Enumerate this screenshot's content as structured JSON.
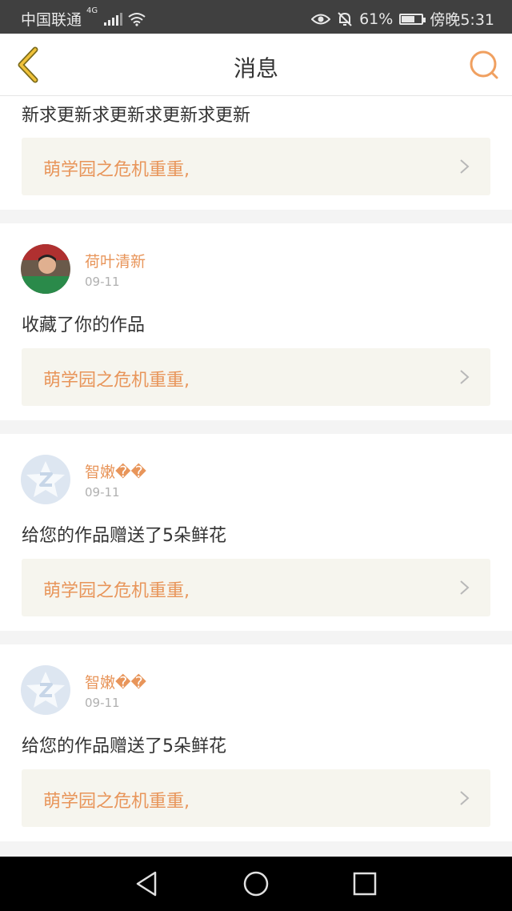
{
  "status_bar": {
    "carrier": "中国联通",
    "network": "4G",
    "battery": "61%",
    "time": "傍晚5:31"
  },
  "header": {
    "title": "消息"
  },
  "cards": [
    {
      "message": "新求更新求更新求更新求更新",
      "link_text": "萌学园之危机重重,"
    },
    {
      "name": "荷叶清新",
      "date": "09-11",
      "message": "收藏了你的作品",
      "link_text": "萌学园之危机重重,"
    },
    {
      "name": "智嫩��",
      "date": "09-11",
      "message": "给您的作品赠送了5朵鲜花",
      "link_text": "萌学园之危机重重,"
    },
    {
      "name": "智嫩��",
      "date": "09-11",
      "message": "给您的作品赠送了5朵鲜花",
      "link_text": "萌学园之危机重重,"
    }
  ],
  "colors": {
    "accent": "#e8955a",
    "link_bg": "#f6f5ee",
    "status_bar": "#404040"
  }
}
